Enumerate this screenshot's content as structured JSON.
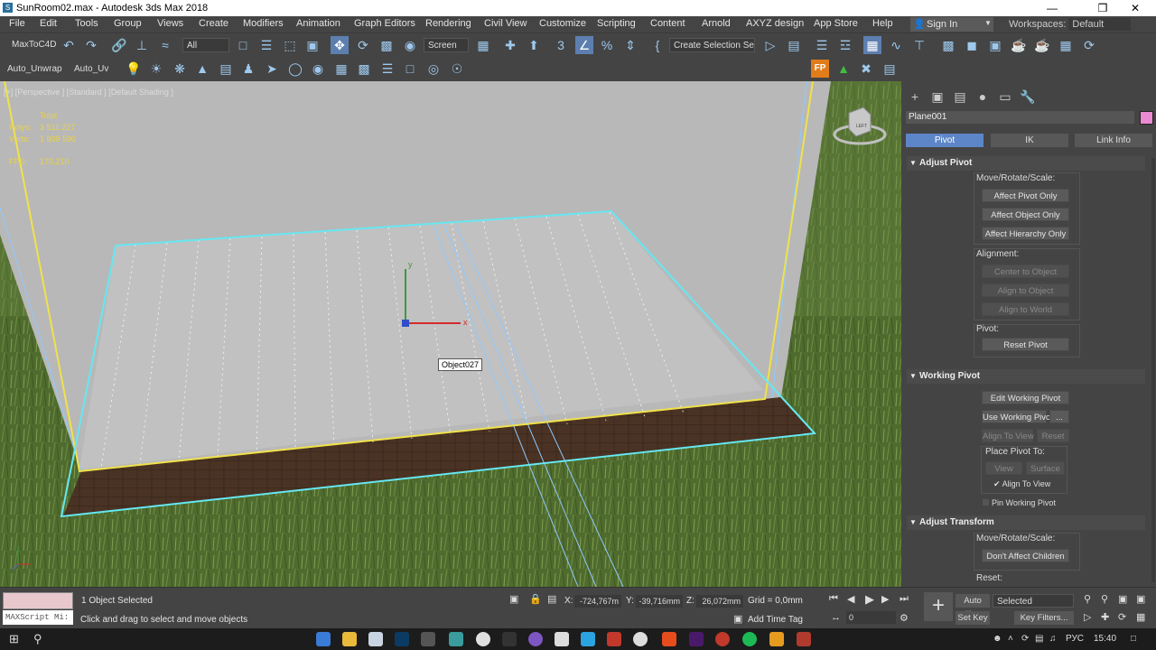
{
  "window": {
    "title": "SunRoom02.max - Autodesk 3ds Max 2018",
    "minimize": "—",
    "maximize": "❒",
    "close": "✕"
  },
  "menu": {
    "items": [
      "File",
      "Edit",
      "Tools",
      "Group",
      "Views",
      "Create",
      "Modifiers",
      "Animation",
      "Graph Editors",
      "Rendering",
      "Civil View",
      "Customize",
      "Scripting",
      "Content",
      "Arnold",
      "AXYZ design",
      "App Store",
      "Help"
    ],
    "sign_in": "Sign In",
    "workspaces_label": "Workspaces:",
    "workspace_value": "Default"
  },
  "toolbar": {
    "maxtoc4d": "MaxToC4D",
    "selection_filter": "All",
    "ref_coord": "Screen",
    "create_selection_set": "Create Selection Se",
    "auto_unwrap": "Auto_Unwrap",
    "auto_uv": "Auto_Uv"
  },
  "viewport": {
    "label": "[+] [Perspective ] [Standard ] [Default Shading ]",
    "stats": {
      "total_label": "Total",
      "polys_label": "Polys:",
      "polys": "3 511 227",
      "verts_label": "Verts:",
      "verts": "1 809 590",
      "fps_label": "FPS:",
      "fps": "170,210"
    },
    "tooltip": "Object027",
    "viewcube_label": "LEFT",
    "gizmo_x": "x",
    "gizmo_y": "y"
  },
  "panel": {
    "object_name": "Plane001",
    "object_color": "#e98ad3",
    "tabs": [
      "Pivot",
      "IK",
      "Link Info"
    ],
    "adjust_pivot": {
      "title": "Adjust Pivot",
      "move_label": "Move/Rotate/Scale:",
      "affect_pivot": "Affect Pivot Only",
      "affect_object": "Affect Object Only",
      "affect_hierarchy": "Affect Hierarchy Only",
      "alignment_label": "Alignment:",
      "center_to_object": "Center to Object",
      "align_to_object": "Align to Object",
      "align_to_world": "Align to World",
      "pivot_label": "Pivot:",
      "reset_pivot": "Reset Pivot"
    },
    "working_pivot": {
      "title": "Working Pivot",
      "edit_working_pivot": "Edit Working Pivot",
      "use_working_pivot": "Use Working Pivot",
      "more": "...",
      "align_to_view": "Align To View",
      "reset": "Reset",
      "place_pivot_to": "Place Pivot To:",
      "view": "View",
      "surface": "Surface",
      "align_to_view_check": "Align To View",
      "pin_working_pivot": "Pin Working Pivot"
    },
    "adjust_transform": {
      "title": "Adjust Transform",
      "move_label": "Move/Rotate/Scale:",
      "dont_affect_children": "Don't Affect Children",
      "reset_label": "Reset:"
    }
  },
  "status": {
    "maxscript": "MAXScript Mi:",
    "selected": "1 Object Selected",
    "prompt": "Click and drag to select and move objects",
    "x_label": "X:",
    "x": "-724,767m",
    "y_label": "Y:",
    "y": "-39,716mm",
    "z_label": "Z:",
    "z": "26,072mm",
    "grid": "Grid = 0,0mm",
    "add_time_tag": "Add Time Tag",
    "frame": "0",
    "auto_key": "Auto Key",
    "set_key": "Set Key",
    "key_mode": "Selected",
    "key_filters": "Key Filters..."
  },
  "taskbar": {
    "lang": "РУС",
    "time": "15:40"
  }
}
